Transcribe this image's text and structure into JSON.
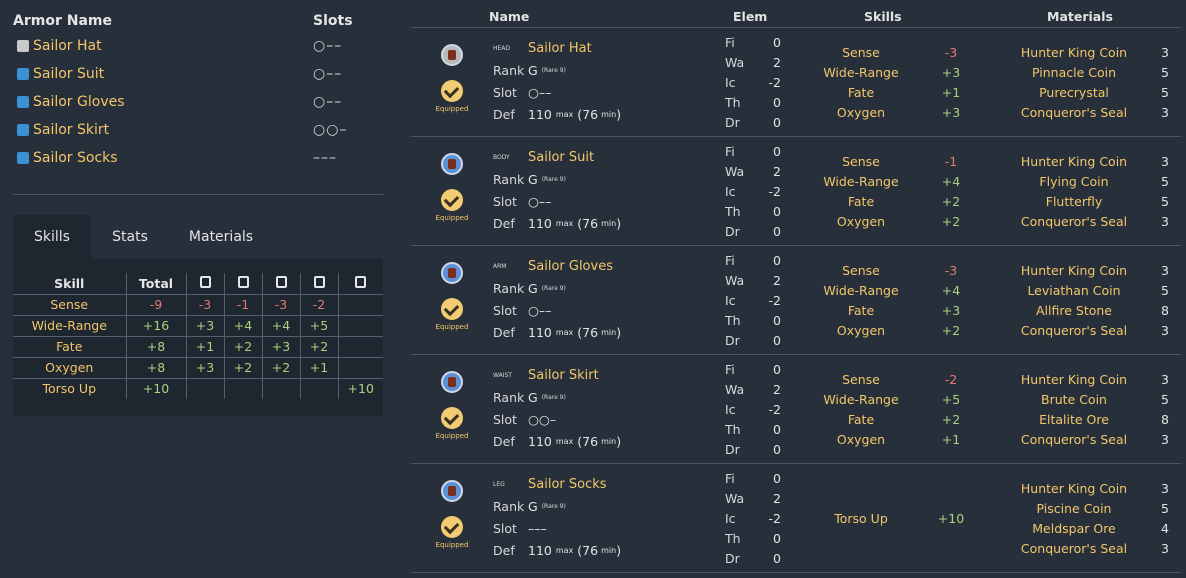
{
  "armor_list": {
    "header_name": "Armor Name",
    "header_slots": "Slots",
    "items": [
      {
        "name": "Sailor Hat",
        "slots": "○––",
        "color": "#c9c9c9"
      },
      {
        "name": "Sailor Suit",
        "slots": "○––",
        "color": "#3b8fd6"
      },
      {
        "name": "Sailor Gloves",
        "slots": "○––",
        "color": "#3b8fd6"
      },
      {
        "name": "Sailor Skirt",
        "slots": "○○–",
        "color": "#3b8fd6"
      },
      {
        "name": "Sailor Socks",
        "slots": "–––",
        "color": "#3b8fd6"
      }
    ]
  },
  "tabs": [
    {
      "label": "Skills",
      "active": true
    },
    {
      "label": "Stats",
      "active": false
    },
    {
      "label": "Materials",
      "active": false
    }
  ],
  "skills_table": {
    "header_skill": "Skill",
    "header_total": "Total",
    "piece_icons": [
      "head-icon",
      "body-icon",
      "arm-icon",
      "waist-icon",
      "leg-icon"
    ],
    "rows": [
      {
        "skill": "Sense",
        "total": "-9",
        "pieces": [
          "-3",
          "-1",
          "-3",
          "-2",
          ""
        ]
      },
      {
        "skill": "Wide-Range",
        "total": "+16",
        "pieces": [
          "+3",
          "+4",
          "+4",
          "+5",
          ""
        ]
      },
      {
        "skill": "Fate",
        "total": "+8",
        "pieces": [
          "+1",
          "+2",
          "+3",
          "+2",
          ""
        ]
      },
      {
        "skill": "Oxygen",
        "total": "+8",
        "pieces": [
          "+3",
          "+2",
          "+2",
          "+1",
          ""
        ]
      },
      {
        "skill": "Torso Up",
        "total": "+10",
        "pieces": [
          "",
          "",
          "",
          "",
          "+10"
        ]
      }
    ]
  },
  "main_header": {
    "name": "Name",
    "elem": "Elem",
    "skills": "Skills",
    "materials": "Materials"
  },
  "labels": {
    "rank": "Rank",
    "slot": "Slot",
    "def": "Def",
    "rare": "Rare 9",
    "max": "max",
    "min": "min",
    "equipped": "Equipped"
  },
  "elem_keys": [
    "Fi",
    "Wa",
    "Ic",
    "Th",
    "Dr"
  ],
  "armors": [
    {
      "type": "HEAD",
      "name": "Sailor Hat",
      "rank": "G",
      "slot": "○––",
      "def": "110",
      "def_min": "(76",
      "elems": [
        "0",
        "2",
        "-2",
        "0",
        "0"
      ],
      "skills": [
        {
          "name": "Sense",
          "value": "-3"
        },
        {
          "name": "Wide-Range",
          "value": "+3"
        },
        {
          "name": "Fate",
          "value": "+1"
        },
        {
          "name": "Oxygen",
          "value": "+3"
        }
      ],
      "materials": [
        {
          "name": "Hunter King Coin",
          "qty": "3"
        },
        {
          "name": "Pinnacle Coin",
          "qty": "5"
        },
        {
          "name": "Purecrystal",
          "qty": "5"
        },
        {
          "name": "Conqueror's Seal",
          "qty": "3"
        }
      ]
    },
    {
      "type": "BODY",
      "name": "Sailor Suit",
      "rank": "G",
      "slot": "○––",
      "def": "110",
      "def_min": "(76",
      "elems": [
        "0",
        "2",
        "-2",
        "0",
        "0"
      ],
      "skills": [
        {
          "name": "Sense",
          "value": "-1"
        },
        {
          "name": "Wide-Range",
          "value": "+4"
        },
        {
          "name": "Fate",
          "value": "+2"
        },
        {
          "name": "Oxygen",
          "value": "+2"
        }
      ],
      "materials": [
        {
          "name": "Hunter King Coin",
          "qty": "3"
        },
        {
          "name": "Flying Coin",
          "qty": "5"
        },
        {
          "name": "Flutterfly",
          "qty": "5"
        },
        {
          "name": "Conqueror's Seal",
          "qty": "3"
        }
      ]
    },
    {
      "type": "ARM",
      "name": "Sailor Gloves",
      "rank": "G",
      "slot": "○––",
      "def": "110",
      "def_min": "(76",
      "elems": [
        "0",
        "2",
        "-2",
        "0",
        "0"
      ],
      "skills": [
        {
          "name": "Sense",
          "value": "-3"
        },
        {
          "name": "Wide-Range",
          "value": "+4"
        },
        {
          "name": "Fate",
          "value": "+3"
        },
        {
          "name": "Oxygen",
          "value": "+2"
        }
      ],
      "materials": [
        {
          "name": "Hunter King Coin",
          "qty": "3"
        },
        {
          "name": "Leviathan Coin",
          "qty": "5"
        },
        {
          "name": "Allfire Stone",
          "qty": "8"
        },
        {
          "name": "Conqueror's Seal",
          "qty": "3"
        }
      ]
    },
    {
      "type": "WAIST",
      "name": "Sailor Skirt",
      "rank": "G",
      "slot": "○○–",
      "def": "110",
      "def_min": "(76",
      "elems": [
        "0",
        "2",
        "-2",
        "0",
        "0"
      ],
      "skills": [
        {
          "name": "Sense",
          "value": "-2"
        },
        {
          "name": "Wide-Range",
          "value": "+5"
        },
        {
          "name": "Fate",
          "value": "+2"
        },
        {
          "name": "Oxygen",
          "value": "+1"
        }
      ],
      "materials": [
        {
          "name": "Hunter King Coin",
          "qty": "3"
        },
        {
          "name": "Brute Coin",
          "qty": "5"
        },
        {
          "name": "Eltalite Ore",
          "qty": "8"
        },
        {
          "name": "Conqueror's Seal",
          "qty": "3"
        }
      ]
    },
    {
      "type": "LEG",
      "name": "Sailor Socks",
      "rank": "G",
      "slot": "–––",
      "def": "110",
      "def_min": "(76",
      "elems": [
        "0",
        "2",
        "-2",
        "0",
        "0"
      ],
      "skills": [
        {
          "name": "Torso Up",
          "value": "+10"
        }
      ],
      "materials": [
        {
          "name": "Hunter King Coin",
          "qty": "3"
        },
        {
          "name": "Piscine Coin",
          "qty": "5"
        },
        {
          "name": "Meldspar Ore",
          "qty": "4"
        },
        {
          "name": "Conqueror's Seal",
          "qty": "3"
        }
      ]
    }
  ],
  "colors": {
    "background": "#27303a",
    "panel": "#1e2630",
    "gold": "#f2c66b",
    "positive": "#a8d27e",
    "negative": "#e27a71",
    "accent_blue": "#3b8fd6"
  }
}
